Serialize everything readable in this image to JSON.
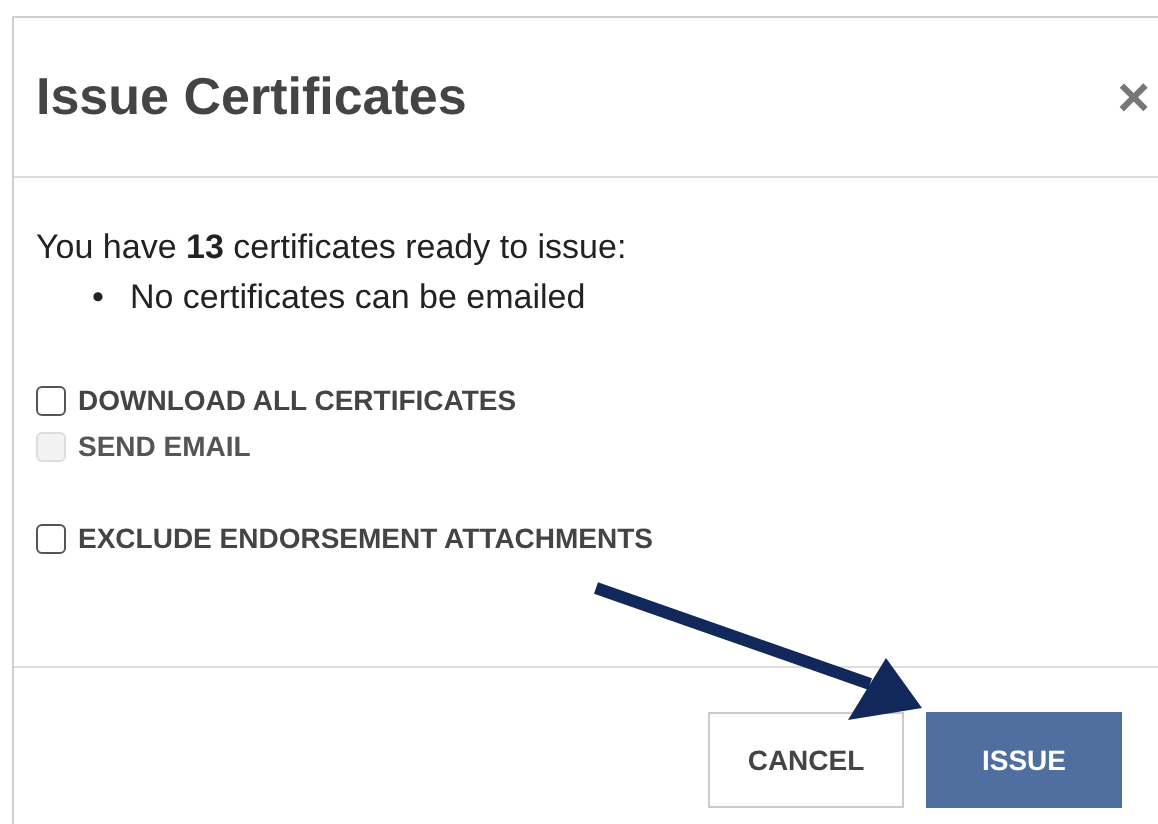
{
  "dialog": {
    "title": "Issue Certificates",
    "close": "×",
    "summary": "You have **13** certificates ready to issue:",
    "notes": [
      {
        "marker": "•",
        "text": "No certificates can be emailed"
      }
    ],
    "option_groups": [
      [
        {
          "label": "DOWNLOAD ALL CERTIFICATES",
          "checked": false,
          "disabled": false
        },
        {
          "label": "SEND EMAIL",
          "checked": false,
          "disabled": true
        }
      ],
      [
        {
          "label": "EXCLUDE ENDORSEMENT ATTACHMENTS",
          "checked": false,
          "disabled": false
        }
      ]
    ],
    "buttons": [
      {
        "label": "CANCEL",
        "kind": "secondary"
      },
      {
        "label": "ISSUE",
        "kind": "primary"
      }
    ]
  }
}
